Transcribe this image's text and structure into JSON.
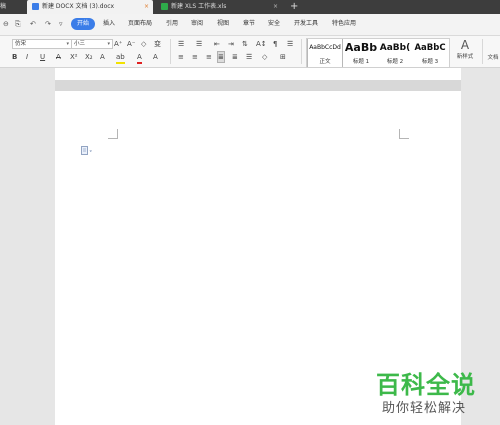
{
  "titlebar": {
    "home_tab": "稿",
    "tabs": [
      {
        "label": "新建 DOCX 文档 (3).docx",
        "close": "×",
        "icon": "doc-icon",
        "color": "#3b7de8"
      },
      {
        "label": "新建 XLS 工作表.xls",
        "close": "×",
        "icon": "xls-icon",
        "color": "#2eaa4a"
      }
    ],
    "new_tab": "+"
  },
  "menubar": {
    "quick_access": [
      "⊖",
      "⎘",
      "↶",
      "↷",
      "▿"
    ],
    "items": [
      "开始",
      "插入",
      "页面布局",
      "引用",
      "审阅",
      "视图",
      "章节",
      "安全",
      "开发工具",
      "特色应用"
    ],
    "active_index": 0
  },
  "ribbon": {
    "font_name": "仿宋",
    "font_size": "小三",
    "dropdown_arrow": "▾",
    "row1_buttons": [
      "A⁺",
      "A⁻",
      "◇",
      "变"
    ],
    "row2_buttons": [
      "B",
      "I",
      "U",
      "A",
      "X²",
      "X₂",
      "A",
      "ab",
      "A",
      "A"
    ],
    "para_row1": [
      "☰",
      "☰",
      "⇤",
      "⇥",
      "⇅",
      "A↕",
      "¶",
      "☰"
    ],
    "para_row2": [
      "≡",
      "≡",
      "≡",
      "≣",
      "≣",
      "☰",
      "◇",
      "⊞"
    ],
    "styles": [
      {
        "sample": "AaBbCcDd",
        "label": "正文"
      },
      {
        "sample": "AaBb",
        "label": "标题 1"
      },
      {
        "sample": "AaBb(",
        "label": "标题 2"
      },
      {
        "sample": "AaBbC",
        "label": "标题 3"
      }
    ],
    "new_style_label": "新样式",
    "doc_tools_label": "文档"
  },
  "watermark": {
    "main": "百科全说",
    "sub": "助你轻松解决"
  },
  "colors": {
    "accent": "#3b7de8",
    "brand_green": "#3db94a"
  }
}
